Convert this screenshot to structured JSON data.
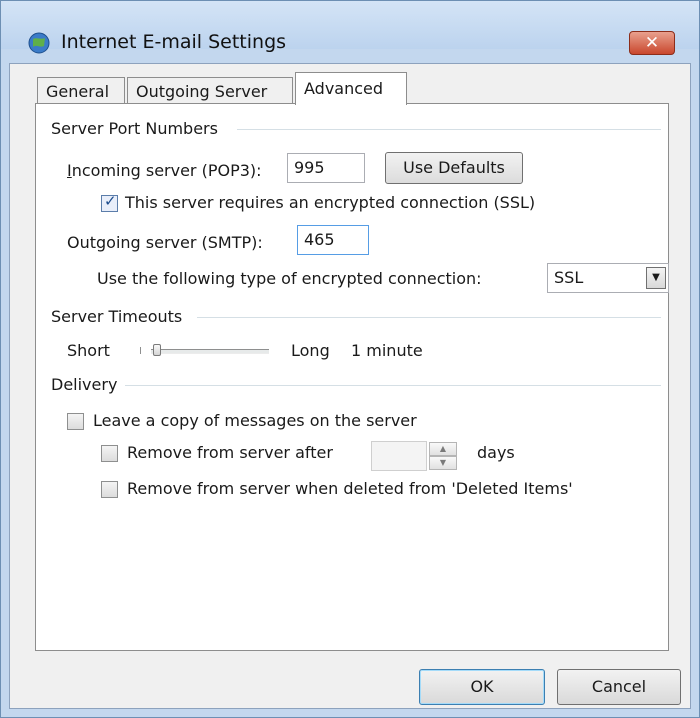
{
  "window": {
    "title": "Internet E-mail Settings",
    "close_label": "✕",
    "icon": "globe-mail-icon"
  },
  "tabs": [
    {
      "label": "General",
      "active": false
    },
    {
      "label": "Outgoing Server",
      "active": false
    },
    {
      "label": "Advanced",
      "active": true
    }
  ],
  "server_ports": {
    "section_label": "Server Port Numbers",
    "incoming_label": "Incoming server (POP3):",
    "incoming_value": "995",
    "use_defaults_label": "Use Defaults",
    "ssl_checkbox_label": "This server requires an encrypted connection (SSL)",
    "ssl_checked": true,
    "outgoing_label": "Outgoing server (SMTP):",
    "outgoing_value": "465",
    "encryption_label": "Use the following type of encrypted connection:",
    "encryption_value": "SSL"
  },
  "timeouts": {
    "section_label": "Server Timeouts",
    "short_label": "Short",
    "long_label": "Long",
    "value_label": "1 minute",
    "slider_level": 0.05
  },
  "delivery": {
    "section_label": "Delivery",
    "leave_copy_label": "Leave a copy of messages on the server",
    "leave_copy_checked": false,
    "remove_after_label": "Remove from server after",
    "remove_after_checked": false,
    "days_label": "days",
    "remove_deleted_label": "Remove from server when deleted from 'Deleted Items'",
    "remove_deleted_checked": false
  },
  "buttons": {
    "ok_label": "OK",
    "cancel_label": "Cancel"
  },
  "colors": {
    "frame": "#c3d7ee",
    "close_button": "#c9472d",
    "default_button_border": "#3c7fb1"
  }
}
